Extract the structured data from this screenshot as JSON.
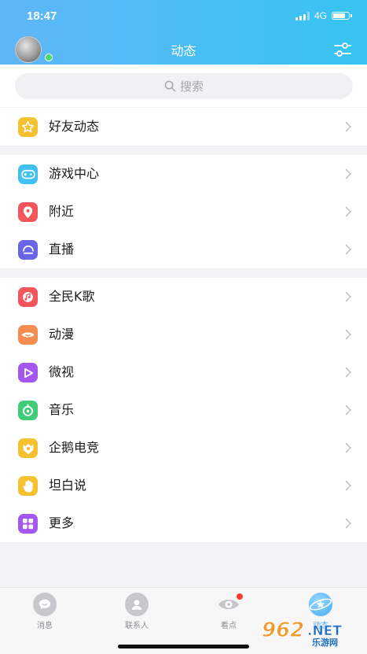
{
  "status_bar": {
    "time": "18:47",
    "network": "4G"
  },
  "header": {
    "title": "动态"
  },
  "search": {
    "placeholder": "搜索"
  },
  "groups": [
    {
      "items": [
        {
          "label": "好友动态",
          "icon": "star-icon",
          "color": "#f6c130"
        }
      ]
    },
    {
      "items": [
        {
          "label": "游戏中心",
          "icon": "gamepad-icon",
          "color": "#3ec1f0"
        },
        {
          "label": "附近",
          "icon": "location-pin-icon",
          "color": "#f2555a"
        },
        {
          "label": "直播",
          "icon": "live-icon",
          "color": "#6a64e6"
        }
      ]
    },
    {
      "items": [
        {
          "label": "全民K歌",
          "icon": "karaoke-icon",
          "color": "#f2555a"
        },
        {
          "label": "动漫",
          "icon": "anime-icon",
          "color": "#f48d4f"
        },
        {
          "label": "微视",
          "icon": "play-icon",
          "color": "#a456f0"
        },
        {
          "label": "音乐",
          "icon": "music-icon",
          "color": "#3fcd79"
        },
        {
          "label": "企鹅电竞",
          "icon": "esports-icon",
          "color": "#f6c130"
        },
        {
          "label": "坦白说",
          "icon": "hand-icon",
          "color": "#f6c130"
        },
        {
          "label": "更多",
          "icon": "grid-icon",
          "color": "#a456f0"
        }
      ]
    }
  ],
  "tabbar": {
    "tabs": [
      {
        "label": "消息",
        "icon": "message-icon"
      },
      {
        "label": "联系人",
        "icon": "contacts-icon"
      },
      {
        "label": "看点",
        "icon": "eye-icon"
      },
      {
        "label": "动态",
        "icon": "planet-icon"
      }
    ]
  },
  "watermark": {
    "text": "962.NET",
    "subtext": "乐游网"
  },
  "colors": {
    "header_start": "#5fb6f7",
    "header_end": "#37c4f2",
    "accent": "#3fa9f5"
  }
}
